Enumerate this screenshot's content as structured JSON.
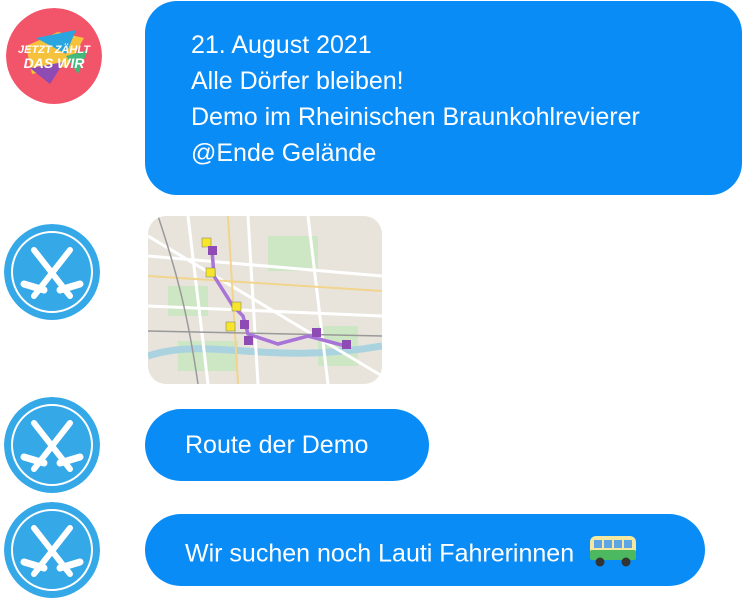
{
  "messages": [
    {
      "sender": "jetzt-zaehlt-das-wir",
      "lines": [
        "21. August 2021",
        "Alle Dörfer bleiben!",
        "Demo im Rheinischen Braunkohlrevierer",
        "@Ende Gelände"
      ]
    },
    {
      "sender": "pickaxe",
      "type": "map-image"
    },
    {
      "sender": "pickaxe",
      "text": "Route der Demo"
    },
    {
      "sender": "pickaxe",
      "text": "Wir suchen noch Lauti Fahrerinnen",
      "emoji": "bus-icon"
    }
  ],
  "avatar1_text": {
    "line1": "JETZT ZÄHLT",
    "line2": "DAS WIR"
  },
  "colors": {
    "bubble": "#0a8cf7",
    "avatar_blue": "#35a8e8",
    "avatar1_red": "#f2546a",
    "route": "#a874d8"
  }
}
